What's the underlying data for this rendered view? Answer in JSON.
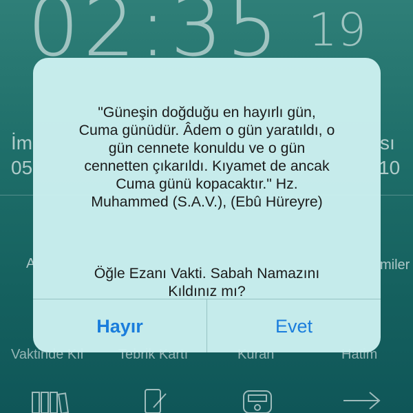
{
  "clock": {
    "time": "02:35",
    "seconds": "19"
  },
  "background": {
    "left_label_partial": "İm",
    "left_value_partial": "05",
    "right_label_partial": "sı",
    "right_value_partial": "10",
    "left_menu_partial": "A",
    "right_menu_partial": "miler",
    "shortcuts": [
      "Vaktinde Kıl",
      "Tebrik Kartı",
      "Kuran",
      "Hatim"
    ],
    "dock_icons": [
      "books-icon",
      "phone-edit-icon",
      "counter-icon",
      "arrow-right-icon"
    ]
  },
  "dialog": {
    "quote": "\"Güneşin doğduğu en hayırlı gün,\nCuma günüdür. Âdem o gün yaratıldı, o\ngün cennete konuldu ve o gün\ncennetten çıkarıldı. Kıyamet de ancak\nCuma günü kopacaktır.\" Hz.\nMuhammed (S.A.V.), (Ebû Hüreyre)",
    "question": "Öğle Ezanı Vakti. Sabah Namazını\nKıldınız mı?",
    "buttons": {
      "no": "Hayır",
      "yes": "Evet"
    }
  },
  "colors": {
    "accent": "#1a7ddc",
    "dialog_bg": "#cbf0f0",
    "background": "#1f6f6a"
  }
}
